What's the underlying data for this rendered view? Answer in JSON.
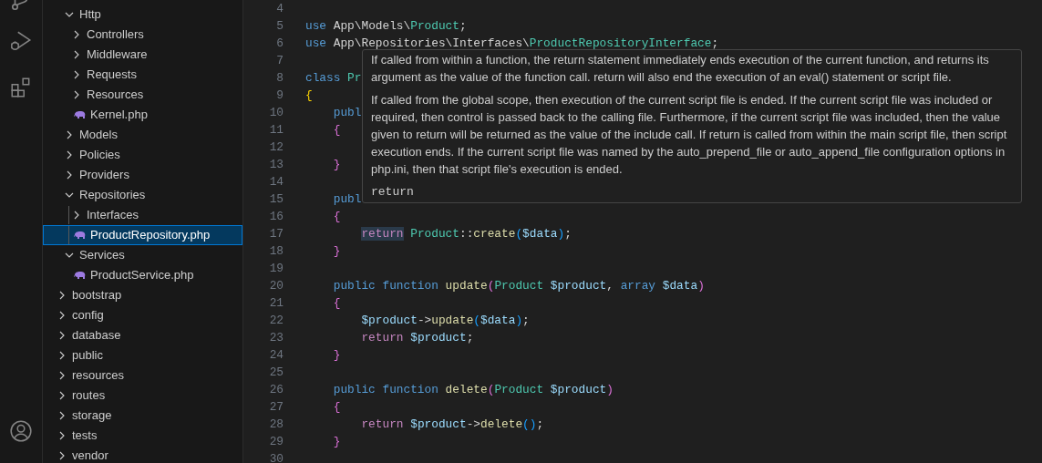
{
  "explorer": [
    {
      "children": [
        {
          "label": "Http",
          "kind": "folder",
          "expanded": true,
          "selected": false,
          "children": [
            {
              "label": "Controllers",
              "kind": "folder",
              "expanded": false,
              "selected": false
            },
            {
              "label": "Middleware",
              "kind": "folder",
              "expanded": false,
              "selected": false
            },
            {
              "label": "Requests",
              "kind": "folder",
              "expanded": false,
              "selected": false
            },
            {
              "label": "Resources",
              "kind": "folder",
              "expanded": false,
              "selected": false
            },
            {
              "label": "Kernel.php",
              "kind": "file",
              "selected": false
            }
          ]
        },
        {
          "label": "Models",
          "kind": "folder",
          "expanded": false,
          "selected": false
        },
        {
          "label": "Policies",
          "kind": "folder",
          "expanded": false,
          "selected": false
        },
        {
          "label": "Providers",
          "kind": "folder",
          "expanded": false,
          "selected": false
        },
        {
          "label": "Repositories",
          "kind": "folder",
          "expanded": true,
          "selected": false,
          "children": [
            {
              "label": "Interfaces",
              "kind": "folder",
              "expanded": false,
              "selected": false
            },
            {
              "label": "ProductRepository.php",
              "kind": "file",
              "selected": true
            }
          ]
        },
        {
          "label": "Services",
          "kind": "folder",
          "expanded": true,
          "selected": false,
          "children": [
            {
              "label": "ProductService.php",
              "kind": "file",
              "selected": false
            }
          ]
        }
      ]
    },
    {
      "label": "bootstrap",
      "kind": "folder",
      "expanded": false,
      "selected": false
    },
    {
      "label": "config",
      "kind": "folder",
      "expanded": false,
      "selected": false
    },
    {
      "label": "database",
      "kind": "folder",
      "expanded": false,
      "selected": false
    },
    {
      "label": "public",
      "kind": "folder",
      "expanded": false,
      "selected": false
    },
    {
      "label": "resources",
      "kind": "folder",
      "expanded": false,
      "selected": false
    },
    {
      "label": "routes",
      "kind": "folder",
      "expanded": false,
      "selected": false
    },
    {
      "label": "storage",
      "kind": "folder",
      "expanded": false,
      "selected": false
    },
    {
      "label": "tests",
      "kind": "folder",
      "expanded": false,
      "selected": false
    },
    {
      "label": "vendor",
      "kind": "folder",
      "expanded": false,
      "selected": false
    }
  ],
  "code_lines": [
    {
      "number": "4"
    },
    {
      "number": "5",
      "tokens": [
        {
          "kind": "keyword",
          "text": "use"
        },
        {
          "kind": "plain",
          "text": " App\\Models\\"
        },
        {
          "kind": "type",
          "text": "Product"
        },
        {
          "kind": "plain",
          "text": ";"
        }
      ]
    },
    {
      "number": "6",
      "tokens": [
        {
          "kind": "keyword",
          "text": "use"
        },
        {
          "kind": "plain",
          "text": " App\\Repositories\\Interfaces\\"
        },
        {
          "kind": "type",
          "text": "ProductRepositoryInterface"
        },
        {
          "kind": "plain",
          "text": ";"
        }
      ]
    },
    {
      "number": "7"
    },
    {
      "number": "8",
      "tokens": [
        {
          "kind": "keyword",
          "text": "class"
        },
        {
          "kind": "type",
          "text": " Pr"
        }
      ]
    },
    {
      "number": "9",
      "tokens": [
        {
          "kind": "bracket1",
          "text": "{"
        }
      ]
    },
    {
      "number": "10",
      "tokens": [
        {
          "kind": "keyword",
          "text": "    publ"
        }
      ]
    },
    {
      "number": "11",
      "tokens": [
        {
          "kind": "bracket2",
          "text": "    {"
        }
      ]
    },
    {
      "number": "12"
    },
    {
      "number": "13",
      "tokens": [
        {
          "kind": "bracket2",
          "text": "    }"
        }
      ]
    },
    {
      "number": "14"
    },
    {
      "number": "15",
      "tokens": [
        {
          "kind": "keyword",
          "text": "    publ"
        }
      ]
    },
    {
      "number": "16",
      "tokens": [
        {
          "kind": "bracket2",
          "text": "    {"
        }
      ]
    },
    {
      "number": "17",
      "tokens": [
        {
          "kind": "control",
          "text": "        return",
          "highlighted": true
        },
        {
          "kind": "type",
          "text": " Product"
        },
        {
          "kind": "plain",
          "text": "::"
        },
        {
          "kind": "function",
          "text": "create"
        },
        {
          "kind": "bracket3",
          "text": "("
        },
        {
          "kind": "variable",
          "text": "$data"
        },
        {
          "kind": "bracket3",
          "text": ")"
        },
        {
          "kind": "plain",
          "text": ";"
        }
      ]
    },
    {
      "number": "18",
      "tokens": [
        {
          "kind": "bracket2",
          "text": "    }"
        }
      ]
    },
    {
      "number": "19"
    },
    {
      "number": "20",
      "tokens": [
        {
          "kind": "keyword",
          "text": "    public function"
        },
        {
          "kind": "function",
          "text": " update"
        },
        {
          "kind": "bracket2",
          "text": "("
        },
        {
          "kind": "type",
          "text": "Product"
        },
        {
          "kind": "variable",
          "text": " $product"
        },
        {
          "kind": "plain",
          "text": ", "
        },
        {
          "kind": "keyword",
          "text": "array"
        },
        {
          "kind": "variable",
          "text": " $data"
        },
        {
          "kind": "bracket2",
          "text": ")"
        }
      ]
    },
    {
      "number": "21",
      "tokens": [
        {
          "kind": "bracket2",
          "text": "    {"
        }
      ]
    },
    {
      "number": "22",
      "tokens": [
        {
          "kind": "variable",
          "text": "        $product"
        },
        {
          "kind": "plain",
          "text": "->"
        },
        {
          "kind": "function",
          "text": "update"
        },
        {
          "kind": "bracket3",
          "text": "("
        },
        {
          "kind": "variable",
          "text": "$data"
        },
        {
          "kind": "bracket3",
          "text": ")"
        },
        {
          "kind": "plain",
          "text": ";"
        }
      ]
    },
    {
      "number": "23",
      "tokens": [
        {
          "kind": "control",
          "text": "        return"
        },
        {
          "kind": "variable",
          "text": " $product"
        },
        {
          "kind": "plain",
          "text": ";"
        }
      ]
    },
    {
      "number": "24",
      "tokens": [
        {
          "kind": "bracket2",
          "text": "    }"
        }
      ]
    },
    {
      "number": "25"
    },
    {
      "number": "26",
      "tokens": [
        {
          "kind": "keyword",
          "text": "    public function"
        },
        {
          "kind": "function",
          "text": " delete"
        },
        {
          "kind": "bracket2",
          "text": "("
        },
        {
          "kind": "type",
          "text": "Product"
        },
        {
          "kind": "variable",
          "text": " $product"
        },
        {
          "kind": "bracket2",
          "text": ")"
        }
      ]
    },
    {
      "number": "27",
      "tokens": [
        {
          "kind": "bracket2",
          "text": "    {"
        }
      ]
    },
    {
      "number": "28",
      "tokens": [
        {
          "kind": "control",
          "text": "        return"
        },
        {
          "kind": "variable",
          "text": " $product"
        },
        {
          "kind": "plain",
          "text": "->"
        },
        {
          "kind": "function",
          "text": "delete"
        },
        {
          "kind": "bracket3",
          "text": "()"
        },
        {
          "kind": "plain",
          "text": ";"
        }
      ]
    },
    {
      "number": "29",
      "tokens": [
        {
          "kind": "bracket2",
          "text": "    }"
        }
      ]
    },
    {
      "number": "30"
    }
  ],
  "hover_tooltip": {
    "paragraphs": [
      "If called from within a function, the return statement immediately ends execution of the current function, and returns its argument as the value of the function call. return will also end the execution of an eval() statement or script file.",
      "If called from the global scope, then execution of the current script file is ended. If the current script file was included or required, then control is passed back to the calling file. Furthermore, if the current script file was included, then the value given to return will be returned as the value of the include call. If return is called from within the main script file, then script execution ends. If the current script file was named by the auto_prepend_file or auto_append_file configuration options in php.ini, then that script file's execution is ended."
    ],
    "signature": "return"
  }
}
